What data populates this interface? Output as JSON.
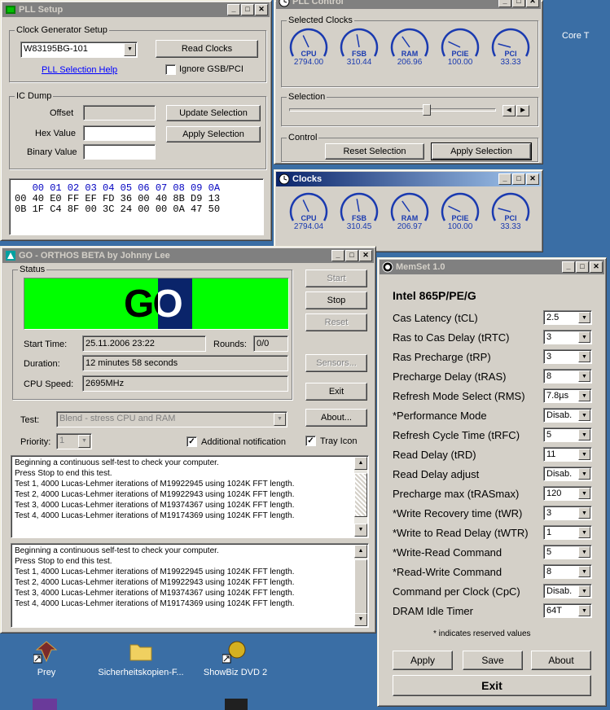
{
  "desktop": {
    "icons": [
      {
        "label": "Prey"
      },
      {
        "label": "Sicherheitskopien-F..."
      },
      {
        "label": "ShowBiz DVD 2"
      },
      {
        "label": "Core T"
      }
    ]
  },
  "pll_setup": {
    "title": "PLL Setup",
    "clock_group": "Clock Generator Setup",
    "chip": "W83195BG-101",
    "read_clocks": "Read Clocks",
    "help_link": "PLL Selection Help",
    "ignore_gsb": "Ignore GSB/PCI",
    "ic_group": "IC Dump",
    "offset_label": "Offset",
    "hex_label": "Hex Value",
    "binary_label": "Binary Value",
    "update_sel": "Update Selection",
    "apply_sel": "Apply Selection",
    "dump": {
      "header": "   00 01 02 03 04 05 06 07 08 09 0A",
      "row0": "00 40 E0 FF EF FD 36 00 40 8B D9 13",
      "row1": "0B 1F C4 8F 00 3C 24 00 00 0A 47 50"
    }
  },
  "pll_control": {
    "title": "PLL Control",
    "selected_group": "Selected Clocks",
    "gauges": [
      {
        "name": "CPU",
        "value": "2794.00"
      },
      {
        "name": "FSB",
        "value": "310.44"
      },
      {
        "name": "RAM",
        "value": "206.96"
      },
      {
        "name": "PCIE",
        "value": "100.00"
      },
      {
        "name": "PCI",
        "value": "33.33"
      }
    ],
    "selection_group": "Selection",
    "control_group": "Control",
    "reset_sel": "Reset Selection",
    "apply_sel": "Apply Selection"
  },
  "clocks": {
    "title": "Clocks",
    "gauges": [
      {
        "name": "CPU",
        "value": "2794.04"
      },
      {
        "name": "FSB",
        "value": "310.45"
      },
      {
        "name": "RAM",
        "value": "206.97"
      },
      {
        "name": "PCIE",
        "value": "100.00"
      },
      {
        "name": "PCI",
        "value": "33.33"
      }
    ]
  },
  "orthos": {
    "title": "GO - ORTHOS BETA by Johnny Lee",
    "status_group": "Status",
    "go_text": "GO",
    "start_time_label": "Start Time:",
    "start_time": "25.11.2006 23:22",
    "rounds_label": "Rounds:",
    "rounds": "0/0",
    "duration_label": "Duration:",
    "duration": "12 minutes 58 seconds",
    "cpu_speed_label": "CPU Speed:",
    "cpu_speed": "2695MHz",
    "start": "Start",
    "stop": "Stop",
    "reset": "Reset",
    "sensors": "Sensors...",
    "exit": "Exit",
    "about": "About...",
    "test_label": "Test:",
    "test_value": "Blend - stress CPU and RAM",
    "priority_label": "Priority:",
    "priority_value": "1",
    "additional_notification": "Additional notification",
    "tray_icon": "Tray Icon",
    "log1": [
      "Beginning a continuous self-test to check your computer.",
      "Press Stop to end this test.",
      "Test 1, 4000 Lucas-Lehmer iterations of M19922945 using 1024K FFT length.",
      "Test 2, 4000 Lucas-Lehmer iterations of M19922943 using 1024K FFT length.",
      "Test 3, 4000 Lucas-Lehmer iterations of M19374367 using 1024K FFT length.",
      "Test 4, 4000 Lucas-Lehmer iterations of M19174369 using 1024K FFT length."
    ],
    "log2": [
      "Beginning a continuous self-test to check your computer.",
      "Press Stop to end this test.",
      "Test 1, 4000 Lucas-Lehmer iterations of M19922945 using 1024K FFT length.",
      "Test 2, 4000 Lucas-Lehmer iterations of M19922943 using 1024K FFT length.",
      "Test 3, 4000 Lucas-Lehmer iterations of M19374367 using 1024K FFT length.",
      "Test 4, 4000 Lucas-Lehmer iterations of M19174369 using 1024K FFT length."
    ]
  },
  "memset": {
    "title": "MemSet 1.0",
    "chipset": "Intel 865P/PE/G",
    "rows": [
      {
        "label": "Cas Latency  (tCL)",
        "value": "2.5"
      },
      {
        "label": "Ras to Cas Delay  (tRTC)",
        "value": "3"
      },
      {
        "label": "Ras Precharge  (tRP)",
        "value": "3"
      },
      {
        "label": "Precharge Delay  (tRAS)",
        "value": "8"
      },
      {
        "label": "Refresh Mode Select  (RMS)",
        "value": "7.8µs"
      },
      {
        "label": "*Performance Mode",
        "value": "Disab."
      },
      {
        "label": "Refresh Cycle Time  (tRFC)",
        "value": "5"
      },
      {
        "label": "Read Delay (tRD)",
        "value": "11"
      },
      {
        "label": "Read Delay adjust",
        "value": "Disab."
      },
      {
        "label": "Precharge max  (tRASmax)",
        "value": "120"
      },
      {
        "label": "*Write Recovery time  (tWR)",
        "value": "3"
      },
      {
        "label": "*Write to Read Delay  (tWTR)",
        "value": "1"
      },
      {
        "label": "*Write-Read Command",
        "value": "5"
      },
      {
        "label": "*Read-Write Command",
        "value": "8"
      },
      {
        "label": "Command per  Clock  (CpC)",
        "value": "Disab."
      },
      {
        "label": "DRAM Idle Timer",
        "value": "64T"
      }
    ],
    "reserved_note": "* indicates reserved values",
    "apply": "Apply",
    "save": "Save",
    "about": "About",
    "exit": "Exit"
  },
  "colors": {
    "go_green": "#00ff00",
    "go_blue": "#0a246a",
    "gauge_blue": "#1a3ab0",
    "title_active": "#0a246a"
  }
}
